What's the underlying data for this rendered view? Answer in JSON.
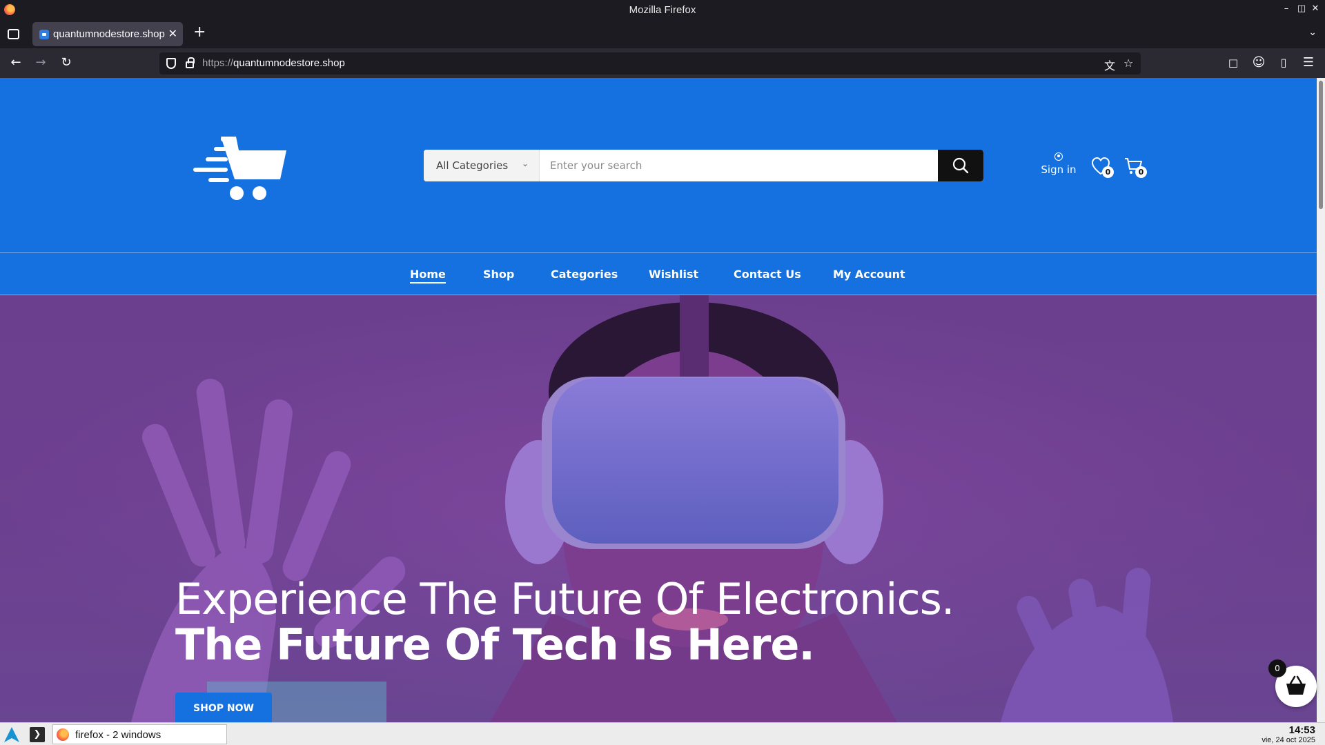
{
  "window": {
    "title": "Mozilla Firefox"
  },
  "browser": {
    "tab_title": "quantumnodestore.shop",
    "url_scheme": "https://",
    "url_host": "quantumnodestore.shop"
  },
  "site": {
    "search": {
      "category": "All Categories",
      "placeholder": "Enter your search"
    },
    "account": {
      "signin_label": "Sign in"
    },
    "wishlist_count": "0",
    "cart_count": "0",
    "menu": [
      "Home",
      "Shop",
      "Categories",
      "Wishlist",
      "Contact Us",
      "My Account"
    ],
    "active_menu": "Home",
    "hero": {
      "line1": "Experience The Future Of Electronics.",
      "line2": "The Future Of Tech Is Here.",
      "cta": "SHOP NOW"
    },
    "basket_count": "0"
  },
  "taskbar": {
    "task_label": "firefox - 2 windows",
    "time": "14:53",
    "date": "vie, 24 oct 2025"
  },
  "colors": {
    "brand_blue": "#1570e0",
    "hero_purple": "#6b3f8e"
  },
  "icons": [
    "firefox-icon",
    "tab-manager-icon",
    "back-icon",
    "forward-icon",
    "reload-icon",
    "shield-icon",
    "lock-icon",
    "translate-icon",
    "star-icon",
    "pocket-icon",
    "account-icon",
    "extensions-icon",
    "menu-icon",
    "cart-logo-icon",
    "search-icon",
    "user-icon",
    "heart-icon",
    "cart-icon",
    "basket-icon"
  ]
}
